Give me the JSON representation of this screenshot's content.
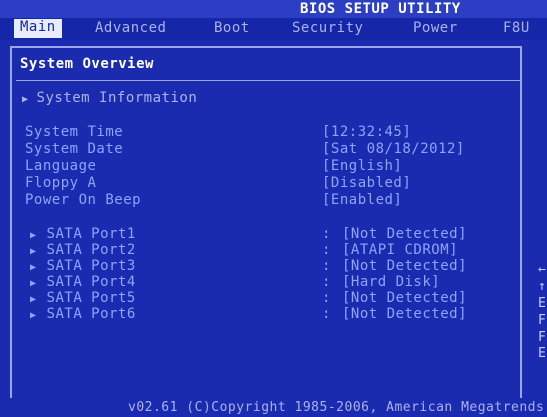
{
  "title": "BIOS SETUP UTILITY",
  "menu": [
    {
      "label": "Main",
      "active": true
    },
    {
      "label": "Advanced"
    },
    {
      "label": "Boot"
    },
    {
      "label": "Security"
    },
    {
      "label": "Power"
    },
    {
      "label": "F8U"
    }
  ],
  "section_title": "System Overview",
  "system_information": "System Information",
  "settings": [
    {
      "label": "System Time",
      "value": "[12:32:45]"
    },
    {
      "label": "System Date",
      "value": "[Sat 08/18/2012]"
    },
    {
      "label": "Language",
      "value": "[English]"
    },
    {
      "label": "Floppy A",
      "value": "[Disabled]"
    },
    {
      "label": "Power On Beep",
      "value": "[Enabled]"
    }
  ],
  "sata_ports": [
    {
      "label": "SATA Port1",
      "value": "[Not Detected]"
    },
    {
      "label": "SATA Port2",
      "value": "[ATAPI CDROM]"
    },
    {
      "label": "SATA Port3",
      "value": "[Not Detected]"
    },
    {
      "label": "SATA Port4",
      "value": "[Hard Disk]"
    },
    {
      "label": "SATA Port5",
      "value": "[Not Detected]"
    },
    {
      "label": "SATA Port6",
      "value": "[Not Detected]"
    }
  ],
  "colon": ":",
  "right_glyphs": [
    "←",
    "↑",
    "E",
    "F",
    "F",
    "E"
  ],
  "footer": "v02.61 (C)Copyright 1985-2006, American Megatrends"
}
